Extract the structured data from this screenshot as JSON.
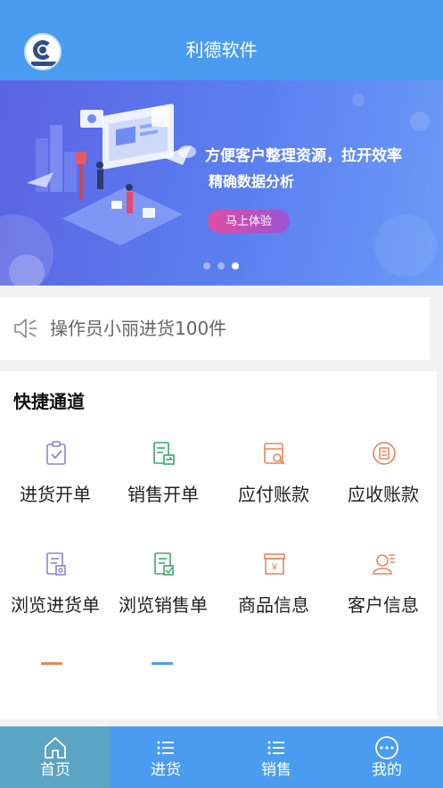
{
  "header": {
    "title": "利德软件",
    "logo_icon": "lide-logo-icon"
  },
  "banner": {
    "headline": "方便客户整理资源，拉开效率",
    "subline": "精确数据分析",
    "cta_label": "马上体验",
    "slide_count": 3,
    "active_slide": 3
  },
  "notice": {
    "icon": "speaker-icon",
    "text": "操作员小丽进货100件"
  },
  "quick": {
    "title": "快捷通道",
    "items": [
      {
        "label": "进货开单",
        "icon": "clipboard-check-icon",
        "color": "#8a84d6"
      },
      {
        "label": "销售开单",
        "icon": "document-transfer-icon",
        "color": "#3aa86a"
      },
      {
        "label": "应付账款",
        "icon": "invoice-search-icon",
        "color": "#e8875a"
      },
      {
        "label": "应收账款",
        "icon": "coin-receipt-icon",
        "color": "#e8875a"
      },
      {
        "label": "浏览进货单",
        "icon": "purchase-order-view-icon",
        "color": "#8a84d6"
      },
      {
        "label": "浏览销售单",
        "icon": "sales-order-view-icon",
        "color": "#3aa86a"
      },
      {
        "label": "商品信息",
        "icon": "yen-box-icon",
        "color": "#e8875a"
      },
      {
        "label": "客户信息",
        "icon": "customer-card-icon",
        "color": "#e8875a"
      }
    ]
  },
  "tabs": [
    {
      "label": "首页",
      "icon": "home-icon",
      "active": true
    },
    {
      "label": "进货",
      "icon": "list-icon",
      "active": false
    },
    {
      "label": "销售",
      "icon": "list-icon",
      "active": false
    },
    {
      "label": "我的",
      "icon": "more-dots-icon",
      "active": false
    }
  ],
  "colors": {
    "primary": "#4a9cf0",
    "active_tab": "#5aa4c4",
    "cta_start": "#e04fa0",
    "cta_end": "#9b54d6"
  }
}
